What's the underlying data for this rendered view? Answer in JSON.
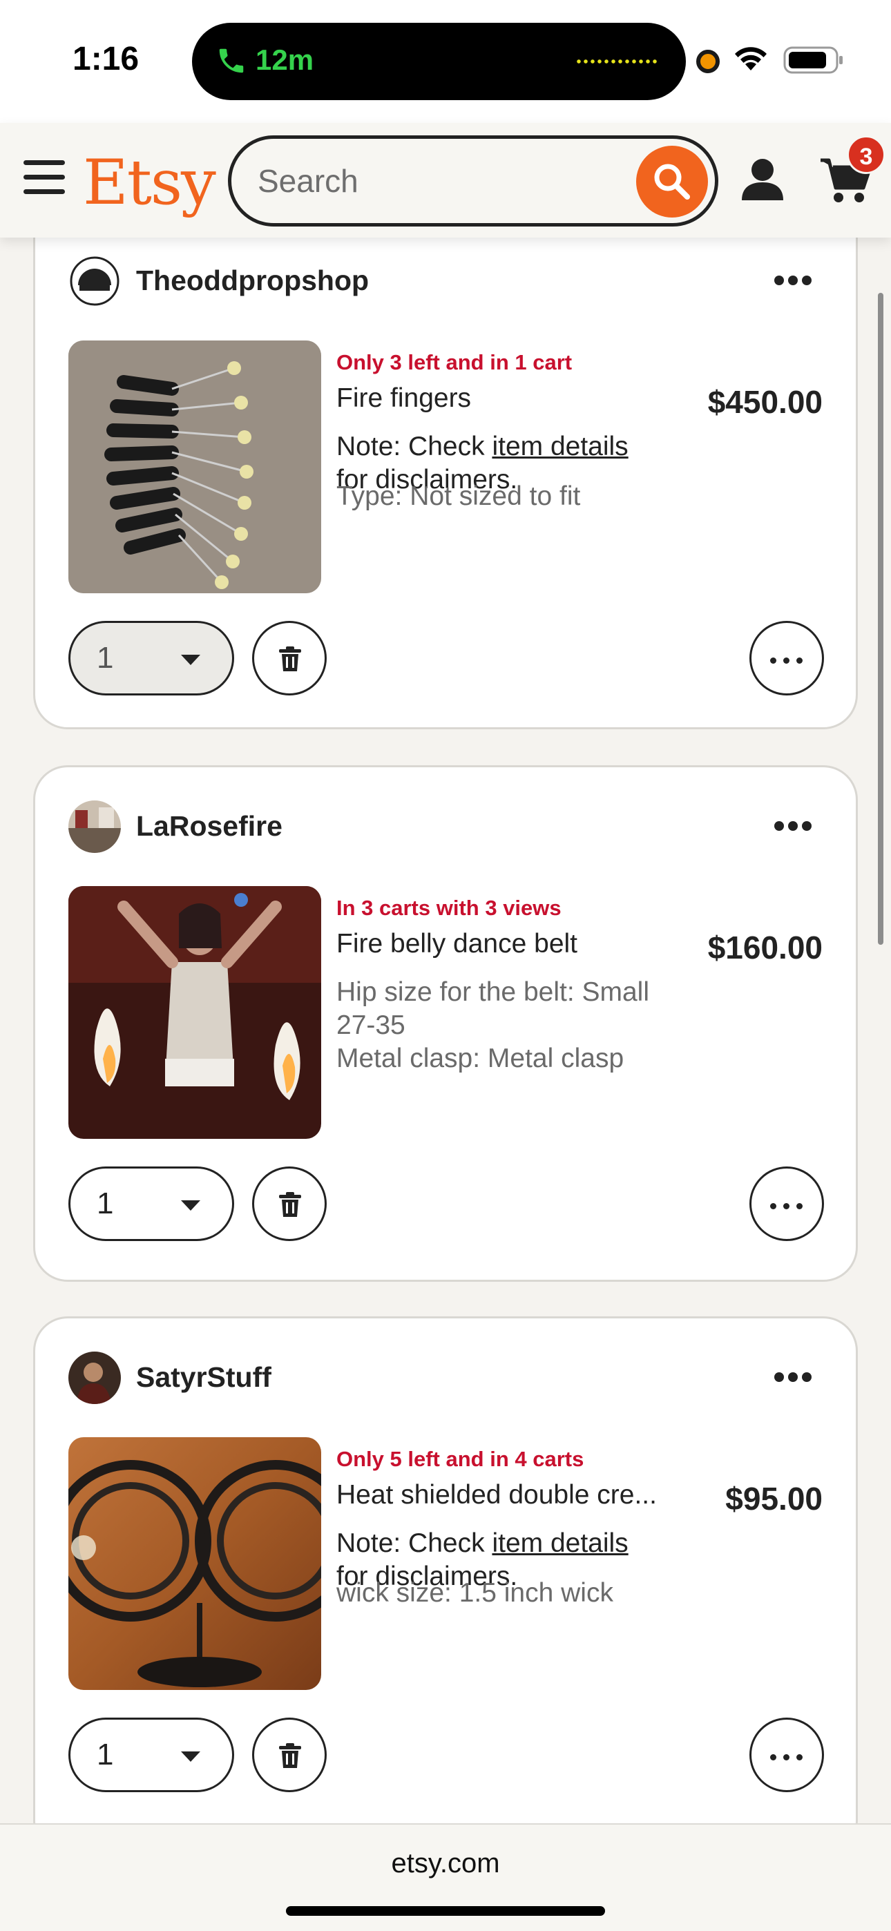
{
  "status_bar": {
    "time": "1:16",
    "call_timer": "12m"
  },
  "header": {
    "logo": "Etsy",
    "search_placeholder": "Search",
    "cart_count": "3",
    "accent_color": "#f1641e"
  },
  "cart_items": [
    {
      "shop": "Theoddpropshop",
      "urgency": "Only 3 left and in 1 cart",
      "title": "Fire fingers",
      "price": "$450.00",
      "note_prefix": "Note: Check ",
      "note_link": "item details",
      "note_suffix": "for disclaimers.",
      "variations": [
        "Type: Not sized to fit"
      ],
      "quantity": "1",
      "quantity_disabled": true
    },
    {
      "shop": "LaRosefire",
      "urgency": "In 3 carts with 3 views",
      "title": "Fire belly dance belt",
      "price": "$160.00",
      "variations": [
        "Hip size for the belt: Small 27-35",
        "Metal clasp: Metal clasp"
      ],
      "quantity": "1",
      "quantity_disabled": false
    },
    {
      "shop": "SatyrStuff",
      "urgency": "Only 5 left and in 4 carts",
      "title": "Heat shielded double cre...",
      "price": "$95.00",
      "note_prefix": "Note: Check ",
      "note_link": "item details",
      "note_suffix": "for disclaimers.",
      "variations": [
        "wick size: 1.5 inch wick"
      ],
      "quantity": "1",
      "quantity_disabled": false
    }
  ],
  "browser": {
    "domain": "etsy.com"
  }
}
